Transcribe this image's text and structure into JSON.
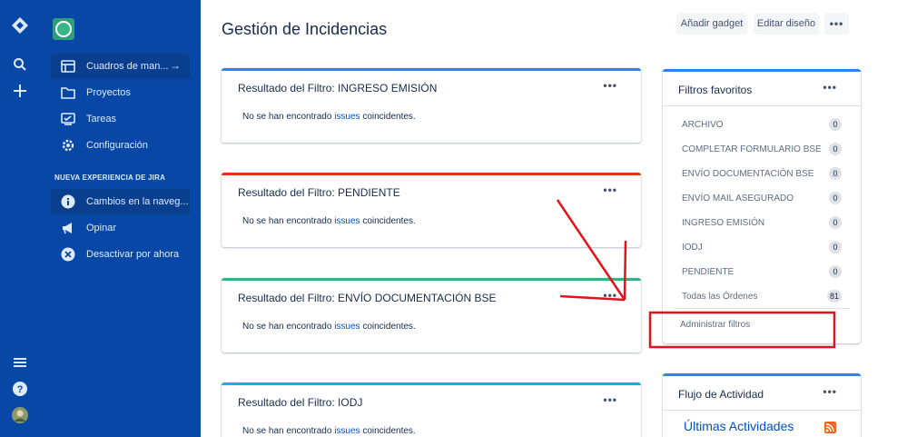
{
  "sidebar": {
    "items": [
      {
        "label": "Cuadros de man...",
        "icon": "board-icon"
      },
      {
        "label": "Proyectos",
        "icon": "folder-icon"
      },
      {
        "label": "Tareas",
        "icon": "issues-icon"
      },
      {
        "label": "Configuración",
        "icon": "gear-icon"
      }
    ],
    "section_label": "NUEVA EXPERIENCIA DE JIRA",
    "section_items": [
      {
        "label": "Cambios en la naveg...",
        "icon": "info-icon"
      },
      {
        "label": "Opinar",
        "icon": "megaphone-icon"
      },
      {
        "label": "Desactivar por ahora",
        "icon": "close-circle-icon"
      }
    ]
  },
  "header": {
    "title": "Gestión de Incidencias",
    "add_gadget": "Añadir gadget",
    "edit_layout": "Editar diseño",
    "more": "•••"
  },
  "gadgets": [
    {
      "title": "Resultado del Filtro: INGRESO EMISIÓN",
      "color": "#2684ff",
      "text_before": "No se han encontrado ",
      "link": "issues",
      "text_after": " coincidentes."
    },
    {
      "title": "Resultado del Filtro: PENDIENTE",
      "color": "#de350b",
      "text_before": "No se han encontrado ",
      "link": "issues",
      "text_after": " coincidentes."
    },
    {
      "title": "Resultado del Filtro: ENVÍO DOCUMENTACIÓN BSE",
      "color": "#36b37e",
      "text_before": "No se han encontrado ",
      "link": "issues",
      "text_after": " coincidentes."
    },
    {
      "title": "Resultado del Filtro: IODJ",
      "color": "#00b8d9",
      "text_before": "No se han encontrado ",
      "link": "issues",
      "text_after": " coincidentes."
    }
  ],
  "favorites": {
    "title": "Filtros favoritos",
    "items": [
      {
        "name": "ARCHIVO",
        "count": "0"
      },
      {
        "name": "COMPLETAR FORMULARIO BSE",
        "count": "0"
      },
      {
        "name": "ENVÍO DOCUMENTACIÓN BSE",
        "count": "0"
      },
      {
        "name": "ENVÍO MAIL ASEGURADO",
        "count": "0"
      },
      {
        "name": "INGRESO EMISIÓN",
        "count": "0"
      },
      {
        "name": "IODJ",
        "count": "0"
      },
      {
        "name": "PENDIENTE",
        "count": "0"
      },
      {
        "name": "Todas las Órdenes",
        "count": "81"
      }
    ],
    "manage": "Administrar filtros"
  },
  "activity": {
    "title": "Flujo de Actividad",
    "heading": "Últimas Actividades"
  },
  "colors": {
    "sidebar": "#0747a6",
    "accent": "#0052cc",
    "annotation": "#e3121b"
  }
}
